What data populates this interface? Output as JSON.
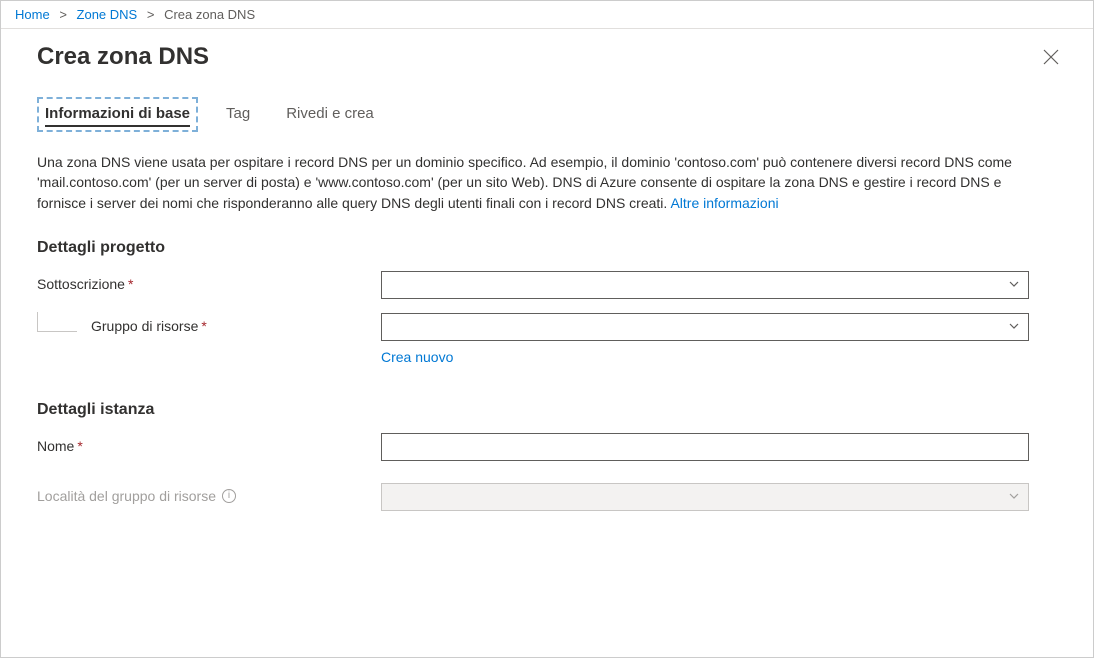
{
  "breadcrumb": {
    "home": "Home",
    "dns_zones": "Zone DNS",
    "current": "Crea zona DNS"
  },
  "header": {
    "title": "Crea zona DNS"
  },
  "tabs": {
    "basics": "Informazioni di base",
    "tags": "Tag",
    "review": "Rivedi e crea"
  },
  "description": {
    "text": "Una zona DNS viene usata per ospitare i record DNS per un dominio specifico. Ad esempio, il dominio 'contoso.com' può contenere diversi record DNS come 'mail.contoso.com' (per un server di posta) e 'www.contoso.com' (per un sito Web). DNS di Azure consente di ospitare la zona DNS e gestire i record DNS e fornisce i server dei nomi che risponderanno alle query DNS degli utenti finali con i record DNS creati.",
    "learn_more": "Altre informazioni"
  },
  "project_details": {
    "title": "Dettagli progetto",
    "subscription_label": "Sottoscrizione",
    "subscription_value": "",
    "resource_group_label": "Gruppo di risorse",
    "resource_group_value": "",
    "create_new": "Crea nuovo"
  },
  "instance_details": {
    "title": "Dettagli istanza",
    "name_label": "Nome",
    "name_value": "",
    "location_label": "Località del gruppo di risorse",
    "location_value": ""
  }
}
